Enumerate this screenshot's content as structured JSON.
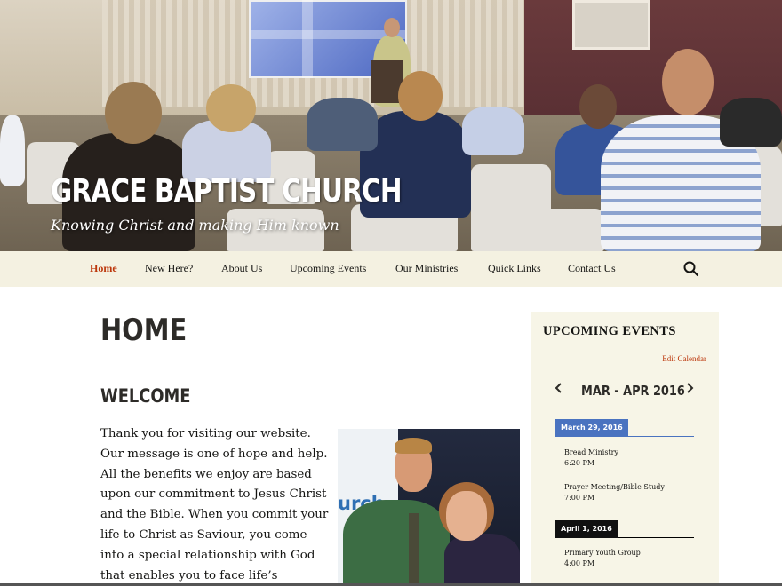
{
  "site": {
    "title": "Grace Baptist Church",
    "description": "Knowing Christ and making Him known"
  },
  "nav": {
    "items": [
      {
        "label": "Home",
        "active": true
      },
      {
        "label": "New Here?"
      },
      {
        "label": "About Us"
      },
      {
        "label": "Upcoming Events"
      },
      {
        "label": "Our Ministries"
      },
      {
        "label": "Quick Links"
      },
      {
        "label": "Contact Us"
      }
    ],
    "search_icon": "search-icon"
  },
  "main": {
    "page_title": "Home",
    "heading": "Welcome",
    "intro": "Thank you for visiting our website. Our message is one of hope and help. All the benefits we enjoy are based upon our commitment to Jesus Christ and the Bible. When you commit your life to Christ as Saviour, you come into a special relationship with God that enables you to face life’s problems and bear them with",
    "photo": {
      "banner_text": "urch"
    }
  },
  "sidebar": {
    "widget_title": "Upcoming Events",
    "edit_link": "Edit Calendar",
    "calendar": {
      "month_range": "Mar - Apr 2016",
      "prev_icon": "chevron-left-icon",
      "next_icon": "chevron-right-icon",
      "days": [
        {
          "date": "March 29, 2016",
          "events": [
            {
              "name": "Bread Ministry",
              "time": "6:20 PM"
            },
            {
              "name": "Prayer Meeting/Bible Study",
              "time": "7:00 PM"
            }
          ]
        },
        {
          "date": "April 1, 2016",
          "events": [
            {
              "name": "Primary Youth Group",
              "time": "4:00 PM"
            }
          ]
        }
      ]
    }
  },
  "colors": {
    "accent": "#bc360a",
    "nav_bg": "#f4f1e1",
    "widget_bg": "#f7f5e7",
    "date_blue": "#4a73c0",
    "date_black": "#111111"
  }
}
